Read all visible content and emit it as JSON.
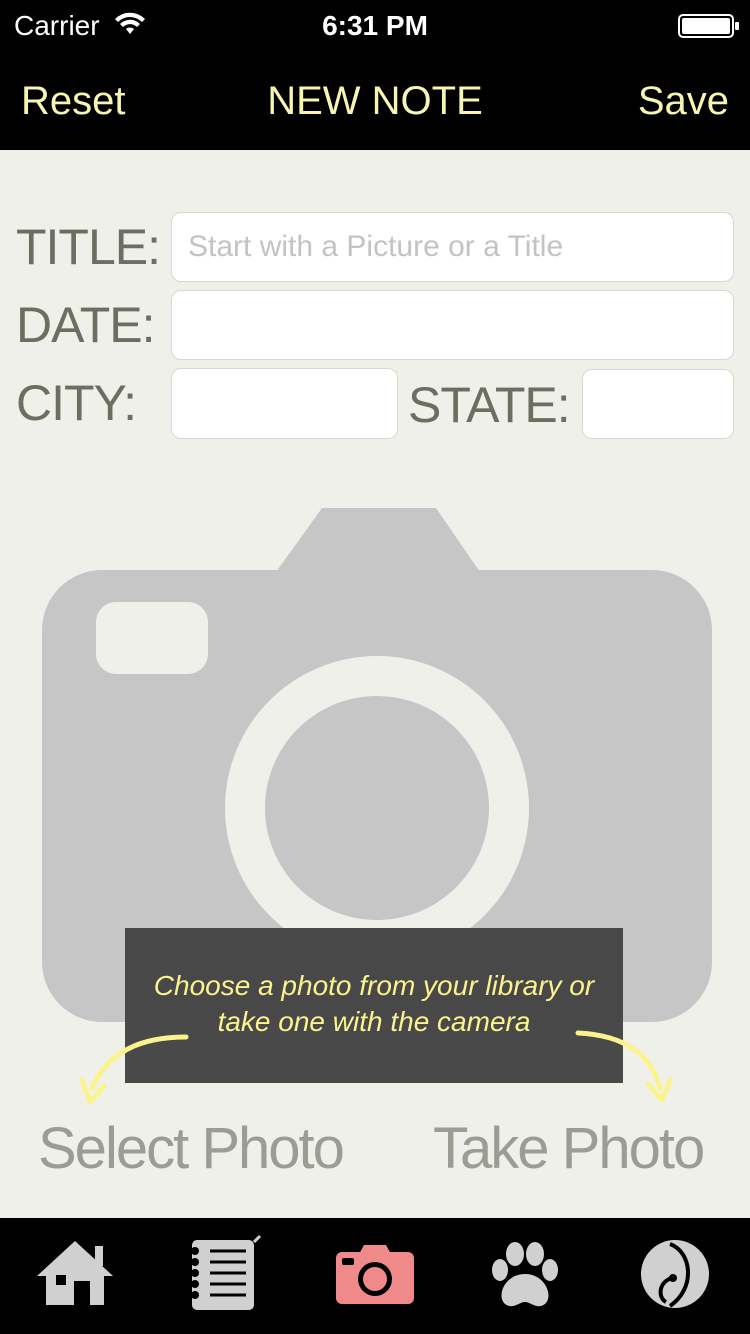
{
  "status_bar": {
    "carrier": "Carrier",
    "time": "6:31 PM"
  },
  "nav": {
    "left_label": "Reset",
    "title": "NEW NOTE",
    "right_label": "Save"
  },
  "form": {
    "title_label": "TITLE:",
    "title_placeholder": "Start with a Picture or a Title",
    "title_value": "",
    "date_label": "DATE:",
    "date_value": "",
    "city_label": "CITY:",
    "city_value": "",
    "state_label": "STATE:",
    "state_value": ""
  },
  "hint": {
    "line1": "Choose a photo from your library or",
    "line2": "take one with the camera"
  },
  "actions": {
    "select_photo": "Select Photo",
    "take_photo": "Take Photo"
  },
  "tabs": [
    {
      "icon": "home-icon",
      "active": false
    },
    {
      "icon": "notebook-icon",
      "active": false
    },
    {
      "icon": "camera-icon",
      "active": true
    },
    {
      "icon": "paw-icon",
      "active": false
    },
    {
      "icon": "moon-logo-icon",
      "active": false
    }
  ],
  "colors": {
    "nav_text": "#f7f5b0",
    "hint_text": "#fbf48c",
    "active_tab": "#f08a8a",
    "inactive_tab": "#d0d0d0"
  }
}
